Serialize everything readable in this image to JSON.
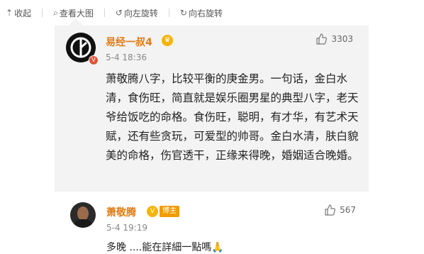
{
  "toolbar": {
    "items": [
      {
        "icon": "collapse-up-icon",
        "label": "收起"
      },
      {
        "icon": "search-icon",
        "label": "查看大图"
      },
      {
        "icon": "rotate-left-icon",
        "label": "向左旋转"
      },
      {
        "icon": "rotate-right-icon",
        "label": "向右旋转"
      }
    ]
  },
  "post": {
    "username": "易经一叔4",
    "timestamp": "5-4 18:36",
    "likes": "3303",
    "content": "萧敬腾八字，比较平衡的庚金男。一句话，金白水清，食伤旺，简直就是娱乐圈男星的典型八字，老天爷给饭吃的命格。食伤旺，聪明，有才华，有艺术天赋，还有些贪玩，可爱型的帅哥。金白水清，肤白貌美的命格，伤官透干，正缘来得晚，婚姻适合晚婚。"
  },
  "reply": {
    "username": "萧敬腾",
    "tag": "博主",
    "timestamp": "5-4 19:19",
    "likes": "567",
    "content": "多晚 ....能在詳細一點嗎🙏"
  },
  "colors": {
    "username": "#e07b14",
    "card_bg": "#f3f3f3",
    "badge": "#f5b400"
  }
}
